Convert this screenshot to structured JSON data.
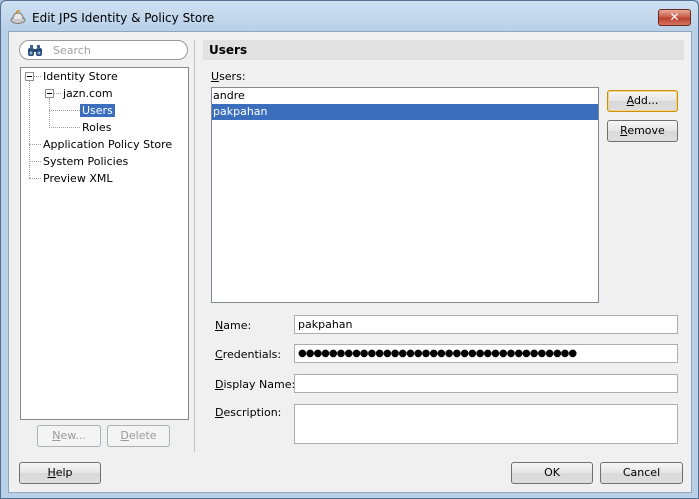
{
  "window": {
    "title": "Edit JPS Identity & Policy Store",
    "close_glyph": "✕"
  },
  "search": {
    "placeholder": "Search",
    "icon": "binoculars-icon"
  },
  "tree": {
    "identity_store": "Identity Store",
    "realm": "jazn.com",
    "users": "Users",
    "roles": "Roles",
    "application_policy_store": "Application Policy Store",
    "system_policies": "System Policies",
    "preview_xml": "Preview XML",
    "selected": "Users"
  },
  "tree_buttons": {
    "new_label": "New...",
    "delete_label": "Delete"
  },
  "panel": {
    "header": "Users",
    "users_label": "Users:",
    "users": [
      "andre",
      "pakpahan"
    ],
    "selected_user": "pakpahan",
    "add_label": "Add...",
    "remove_label": "Remove"
  },
  "form": {
    "name_label": "Name:",
    "name_value": "pakpahan",
    "credentials_label": "Credentials:",
    "credentials_value": "●●●●●●●●●●●●●●●●●●●●●●●●●●●●●●●●●●●●",
    "display_name_label": "Display Name:",
    "display_name_value": "",
    "description_label": "Description:",
    "description_value": ""
  },
  "footer": {
    "help_label": "Help",
    "ok_label": "OK",
    "cancel_label": "Cancel"
  },
  "colors": {
    "selection": "#3b6fbd",
    "title_bar": "#b9d0e8",
    "close_button": "#c75a45"
  }
}
